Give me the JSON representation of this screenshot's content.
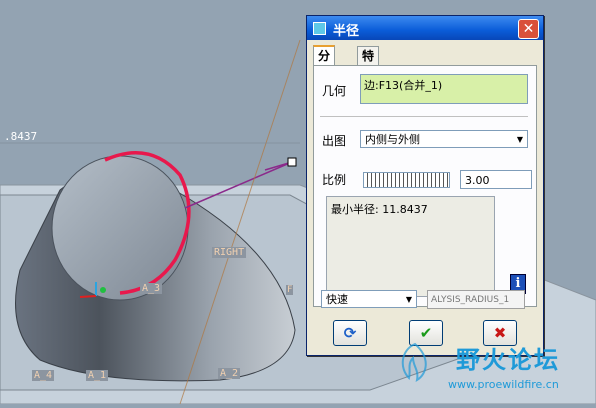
{
  "viewport": {
    "dimension_value": ".8437",
    "datum_labels": [
      "RIGHT",
      "A_4",
      "A_3",
      "A_2",
      "A_1",
      "F"
    ]
  },
  "dialog": {
    "title": "半径",
    "close_glyph": "✕",
    "tabs": [
      "分析",
      "特征"
    ],
    "geometry_label": "几何",
    "geometry_value": "边:F13(合并_1)",
    "output_label": "出图",
    "output_value": "内侧与外侧",
    "scale_label": "比例",
    "scale_value": "3.00",
    "result_text": "最小半径: 11.8437",
    "info_glyph": "i",
    "mode_value": "快速",
    "param_name": "ALYSIS_RADIUS_1",
    "buttons": {
      "repeat_glyph": "⟳",
      "ok_glyph": "✔",
      "cancel_glyph": "✖"
    }
  },
  "watermark": {
    "site_name": "野火论坛",
    "url": "www.proewildfire.cn"
  },
  "colors": {
    "title_bar": "#0a5cd8",
    "geometry_field": "#d8f0a8",
    "curvature_plot": "#e8184c",
    "watermark": "#1f9ad8"
  }
}
